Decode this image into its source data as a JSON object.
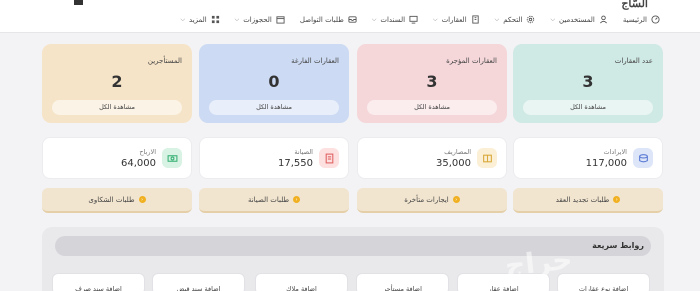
{
  "header": {
    "logo": "السّاج",
    "nav": [
      {
        "label": "الرئيسية",
        "icon": "gauge-icon",
        "dropdown": false
      },
      {
        "label": "المستخدمين",
        "icon": "user-icon",
        "dropdown": true
      },
      {
        "label": "التحكم",
        "icon": "gear-icon",
        "dropdown": true
      },
      {
        "label": "العقارات",
        "icon": "building-icon",
        "dropdown": true
      },
      {
        "label": "السندات",
        "icon": "monitor-icon",
        "dropdown": true
      },
      {
        "label": "طلبات التواصل",
        "icon": "inbox-icon",
        "dropdown": false
      },
      {
        "label": "الحجوزات",
        "icon": "calendar-icon",
        "dropdown": true
      },
      {
        "label": "المزيد",
        "icon": "grid-icon",
        "dropdown": true
      }
    ]
  },
  "stats": [
    {
      "title": "عدد العقارات",
      "value": "3",
      "button": "مشاهدة الكل",
      "color": "#cfe9e4"
    },
    {
      "title": "العقارات المؤجرة",
      "value": "3",
      "button": "مشاهدة الكل",
      "color": "#f5d7da"
    },
    {
      "title": "العقارات الفارغة",
      "value": "0",
      "button": "مشاهدة الكل",
      "color": "#ccdaf3"
    },
    {
      "title": "المستأجرين",
      "value": "2",
      "button": "مشاهدة الكل",
      "color": "#f6e4c8"
    }
  ],
  "minis": [
    {
      "label": "الايرادات",
      "value": "117,000",
      "icon": "coins-icon",
      "color": "#dde5f8"
    },
    {
      "label": "المصاريف",
      "value": "35,000",
      "icon": "wallet-icon",
      "color": "#fbf0d6"
    },
    {
      "label": "الصيانة",
      "value": "17,550",
      "icon": "invoice-icon",
      "color": "#fde1e1"
    },
    {
      "label": "الارباح",
      "value": "64,000",
      "icon": "cash-icon",
      "color": "#d8f2e4"
    }
  ],
  "actions": [
    {
      "label": "طلبات تجديد العقد"
    },
    {
      "label": "ايجارات متأخرة"
    },
    {
      "label": "طلبات الصيانة"
    },
    {
      "label": "طلبات الشكاوى"
    }
  ],
  "quick_links": {
    "title": "روابط سريعة",
    "items": [
      "اضافة نوع عقارات",
      "اضافة عقار",
      "اضافة مستأجر",
      "اضافة ملاك",
      "اضافة سند قبض",
      "اضافة سند صرف"
    ]
  },
  "watermark": "حراج"
}
